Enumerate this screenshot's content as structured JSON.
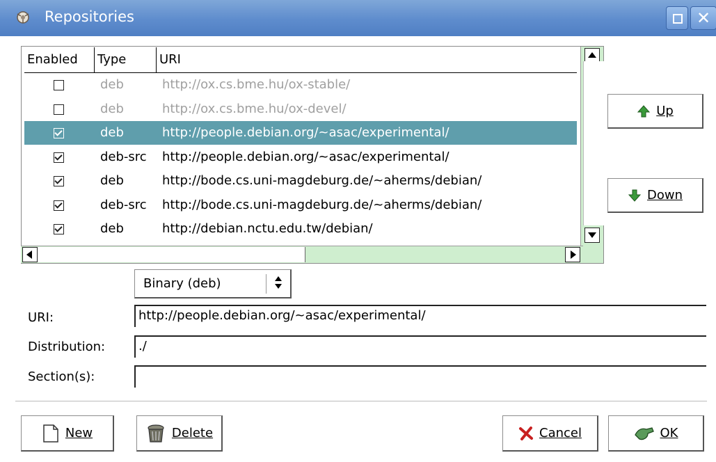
{
  "window": {
    "title": "Repositories"
  },
  "list": {
    "columns": [
      "Enabled",
      "Type",
      "URI"
    ],
    "rows": [
      {
        "enabled": false,
        "type": "deb",
        "uri": "http://ox.cs.bme.hu/ox-stable/",
        "state": "disabled"
      },
      {
        "enabled": false,
        "type": "deb",
        "uri": "http://ox.cs.bme.hu/ox-devel/",
        "state": "disabled"
      },
      {
        "enabled": true,
        "type": "deb",
        "uri": "http://people.debian.org/~asac/experimental/",
        "state": "selected"
      },
      {
        "enabled": true,
        "type": "deb-src",
        "uri": "http://people.debian.org/~asac/experimental/",
        "state": "normal"
      },
      {
        "enabled": true,
        "type": "deb",
        "uri": "http://bode.cs.uni-magdeburg.de/~aherms/debian/",
        "state": "normal"
      },
      {
        "enabled": true,
        "type": "deb-src",
        "uri": "http://bode.cs.uni-magdeburg.de/~aherms/debian/",
        "state": "normal"
      },
      {
        "enabled": true,
        "type": "deb",
        "uri": "http://debian.nctu.edu.tw/debian/",
        "state": "normal"
      }
    ]
  },
  "side_buttons": {
    "up_label": "Up",
    "down_label": "Down"
  },
  "type_combo": {
    "selected": "Binary (deb)"
  },
  "form": {
    "uri_label": "URI:",
    "uri_value": "http://people.debian.org/~asac/experimental/",
    "distribution_label": "Distribution:",
    "distribution_value": "./",
    "sections_label": "Section(s):",
    "sections_value": ""
  },
  "bottom_buttons": {
    "new_label": "New",
    "delete_label": "Delete",
    "cancel_label": "Cancel",
    "ok_label": "OK"
  },
  "colors": {
    "titlebar": "#5e8ccd",
    "selection": "#5f9eac",
    "scroll_trough": "#cfeecf",
    "up_icon": "#3a9a3a",
    "cancel_icon": "#c82020"
  }
}
